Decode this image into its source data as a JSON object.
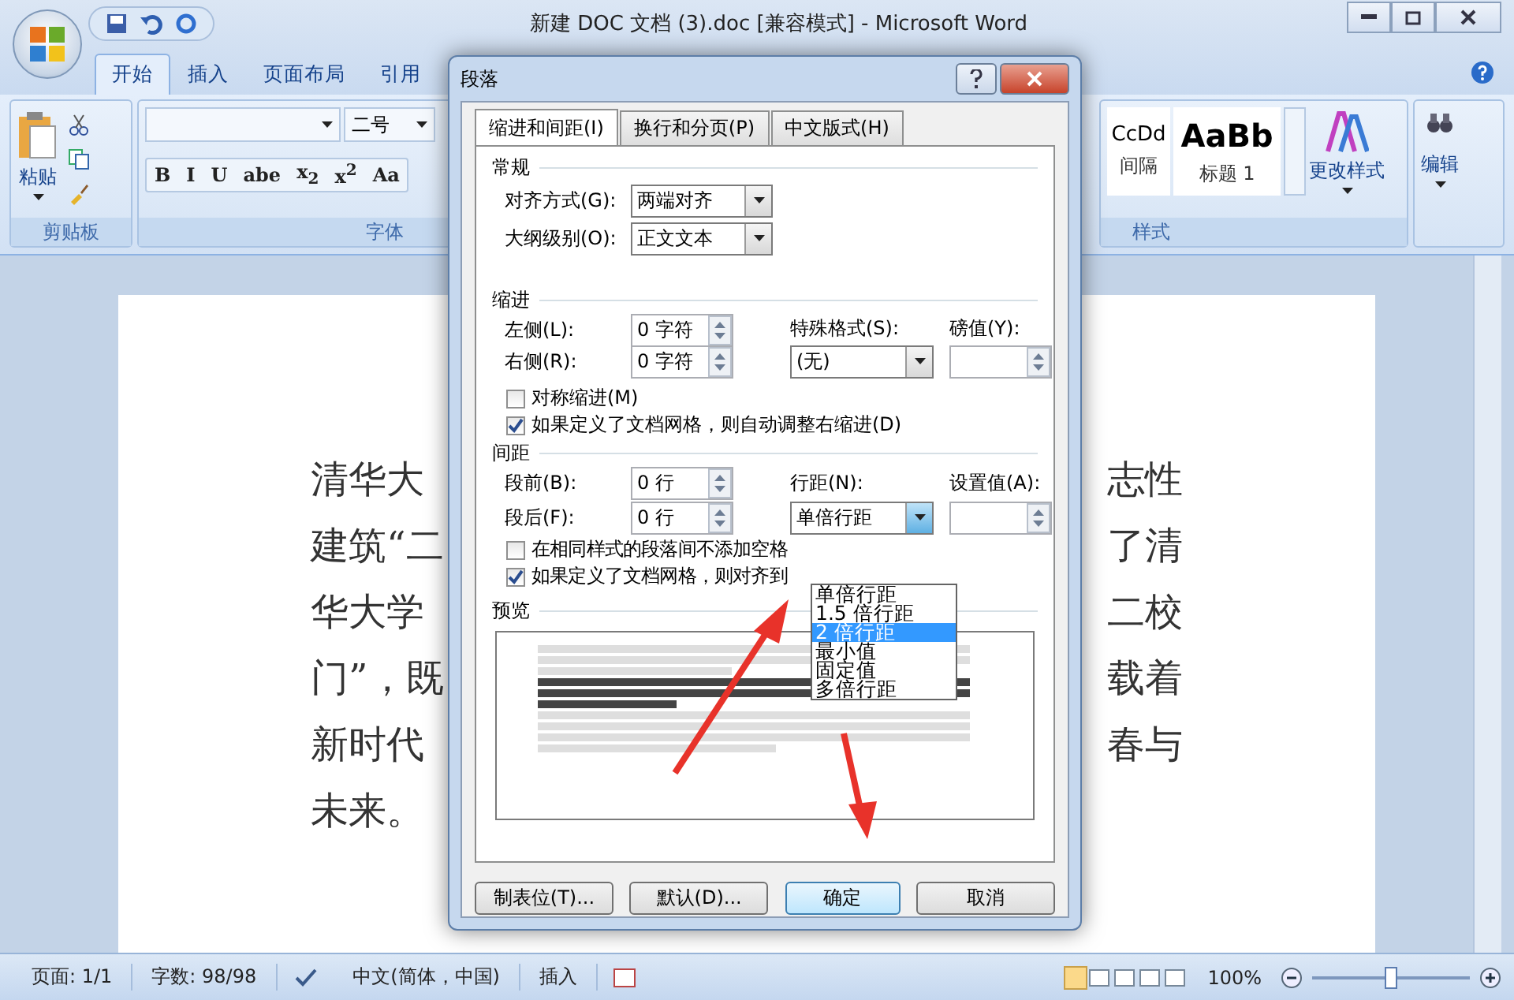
{
  "window": {
    "title": "新建 DOC 文档 (3).doc [兼容模式] - Microsoft Word"
  },
  "ribbon_tabs": [
    {
      "label": "开始",
      "selected": true
    },
    {
      "label": "插入",
      "selected": false
    },
    {
      "label": "页面布局",
      "selected": false
    },
    {
      "label": "引用",
      "selected": false
    }
  ],
  "clipboard": {
    "paste": "粘贴",
    "group_label": "剪贴板"
  },
  "font": {
    "size": "二号",
    "buttons": [
      "B",
      "I",
      "U",
      "abe",
      "x$_{2}$",
      "x$^{2}$",
      "Aa"
    ],
    "group_label": "字体"
  },
  "styles": {
    "items": [
      {
        "sample": "CcDd",
        "name": "间隔"
      },
      {
        "sample": "AaBb",
        "name": "标题 1"
      }
    ],
    "change_styles": "更改样式",
    "group_label": "样式"
  },
  "editing": {
    "label": "编辑"
  },
  "document": {
    "left_lines": [
      "清华大",
      "建筑“二",
      "华大学",
      "门”，既",
      "新时代",
      "未来。"
    ],
    "right_lines": [
      "志性",
      "了清",
      "二校",
      "载着",
      "春与"
    ]
  },
  "status_bar": {
    "page": "页面: 1/1",
    "words": "字数: 98/98",
    "language": "中文(简体，中国)",
    "mode": "插入",
    "zoom": "100%",
    "level": 0.5
  },
  "dialog": {
    "title": "段落",
    "tabs": [
      {
        "label": "缩进和间距(I)",
        "selected": true
      },
      {
        "label": "换行和分页(P)",
        "selected": false
      },
      {
        "label": "中文版式(H)",
        "selected": false
      }
    ],
    "general": {
      "heading": "常规",
      "alignment_label": "对齐方式(G):",
      "alignment": "两端对齐",
      "outline_label": "大纲级别(O):",
      "outline": "正文文本"
    },
    "indent": {
      "heading": "缩进",
      "left_label": "左侧(L):",
      "left": "0 字符",
      "right_label": "右侧(R):",
      "right": "0 字符",
      "special_label": "特殊格式(S):",
      "special": "(无)",
      "by_label": "磅值(Y):",
      "checks": [
        {
          "label": "对称缩进(M)",
          "checked": false
        },
        {
          "label": "如果定义了文档网格，则自动调整右缩进(D)",
          "checked": true
        }
      ]
    },
    "spacing": {
      "heading": "间距",
      "before_label": "段前(B):",
      "before": "0 行",
      "after_label": "段后(F):",
      "after": "0 行",
      "line_label": "行距(N):",
      "line": "单倍行距",
      "at_label": "设置值(A):",
      "checks": [
        {
          "label": "在相同样式的段落间不添加空格",
          "checked": false
        },
        {
          "label": "如果定义了文档网格，则对齐到",
          "checked": true
        }
      ],
      "options": [
        {
          "label": "单倍行距",
          "selected": false
        },
        {
          "label": "1.5 倍行距",
          "selected": false
        },
        {
          "label": "2 倍行距",
          "selected": true
        },
        {
          "label": "最小值",
          "selected": false
        },
        {
          "label": "固定值",
          "selected": false
        },
        {
          "label": "多倍行距",
          "selected": false
        }
      ]
    },
    "preview_heading": "预览",
    "buttons": [
      {
        "label": "制表位(T)...",
        "kind": "normal"
      },
      {
        "label": "默认(D)...",
        "kind": "normal"
      },
      {
        "label": "确定",
        "kind": "default"
      },
      {
        "label": "取消",
        "kind": "normal"
      }
    ]
  }
}
